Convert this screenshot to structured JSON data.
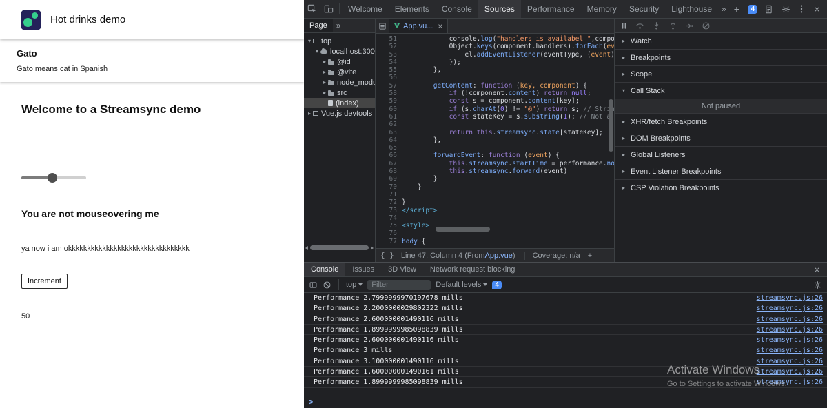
{
  "app": {
    "title": "Hot drinks demo",
    "gato_title": "Gato",
    "gato_subtitle": "Gato means cat in Spanish",
    "welcome_heading": "Welcome to a Streamsync demo",
    "mouseover_heading": "You are not mouseovering me",
    "mouseover_text": "ya now i am okkkkkkkkkkkkkkkkkkkkkkkkkkkkkkkk",
    "increment_button": "Increment",
    "counter_value": "50",
    "slider": {
      "percent": 48
    }
  },
  "devtools": {
    "top_tabs": [
      "Welcome",
      "Elements",
      "Console",
      "Sources",
      "Performance",
      "Memory",
      "Security",
      "Lighthouse"
    ],
    "selected_top_tab": "Sources",
    "more_tabs_icon": "»",
    "new_tab_icon": "+",
    "badge_count": "4",
    "sources": {
      "navigator": {
        "tab_label": "Page",
        "more_icon": "»",
        "tree": [
          {
            "label": "top",
            "depth": 0,
            "state": "expanded",
            "icon": "frame"
          },
          {
            "label": "localhost:3000",
            "depth": 1,
            "state": "expanded",
            "icon": "cloud"
          },
          {
            "label": "@id",
            "depth": 2,
            "state": "collapsed",
            "icon": "folder"
          },
          {
            "label": "@vite",
            "depth": 2,
            "state": "collapsed",
            "icon": "folder"
          },
          {
            "label": "node_modu...",
            "depth": 2,
            "state": "collapsed",
            "icon": "folder"
          },
          {
            "label": "src",
            "depth": 2,
            "state": "collapsed",
            "icon": "folder"
          },
          {
            "label": "(index)",
            "depth": 2,
            "state": "leaf",
            "icon": "file",
            "selected": true
          },
          {
            "label": "Vue.js devtools",
            "depth": 0,
            "state": "collapsed",
            "icon": "frame"
          }
        ]
      },
      "editor": {
        "tab_label": "App.vu...",
        "close_icon": "×",
        "first_line": 51,
        "lines": [
          {
            "n": 51,
            "t": [
              [
                "            console.",
                "p"
              ],
              [
                "log",
                "f"
              ],
              [
                "(",
                "p"
              ],
              [
                "\"handlers is availabel \"",
                "s"
              ],
              [
                ",component",
                "p"
              ]
            ]
          },
          {
            "n": 52,
            "t": [
              [
                "            Object.",
                "p"
              ],
              [
                "keys",
                "f"
              ],
              [
                "(component.handlers).",
                "p"
              ],
              [
                "forEach",
                "f"
              ],
              [
                "(",
                "p"
              ],
              [
                "event",
                "d"
              ]
            ]
          },
          {
            "n": 53,
            "t": [
              [
                "                el.",
                "p"
              ],
              [
                "addEventListener",
                "f"
              ],
              [
                "(eventType, (",
                "p"
              ],
              [
                "event",
                "d"
              ],
              [
                ") =>",
                "p"
              ]
            ]
          },
          {
            "n": 54,
            "t": [
              [
                "            });",
                "p"
              ]
            ]
          },
          {
            "n": 55,
            "t": [
              [
                "        },",
                "p"
              ]
            ]
          },
          {
            "n": 56,
            "t": []
          },
          {
            "n": 57,
            "t": [
              [
                "        ",
                "p"
              ],
              [
                "getContent",
                "f"
              ],
              [
                ": ",
                "p"
              ],
              [
                "function",
                "k"
              ],
              [
                " (",
                "p"
              ],
              [
                "key, component",
                "d"
              ],
              [
                ") {",
                "p"
              ]
            ]
          },
          {
            "n": 58,
            "t": [
              [
                "            ",
                "p"
              ],
              [
                "if",
                "k"
              ],
              [
                " (!component.",
                "p"
              ],
              [
                "content",
                "f"
              ],
              [
                ") ",
                "p"
              ],
              [
                "return",
                "k"
              ],
              [
                " ",
                "p"
              ],
              [
                "null",
                "n"
              ],
              [
                ";",
                "p"
              ]
            ]
          },
          {
            "n": 59,
            "t": [
              [
                "            ",
                "p"
              ],
              [
                "const",
                "k"
              ],
              [
                " s = component.",
                "p"
              ],
              [
                "content",
                "f"
              ],
              [
                "[key];",
                "p"
              ]
            ]
          },
          {
            "n": 60,
            "t": [
              [
                "            ",
                "p"
              ],
              [
                "if",
                "k"
              ],
              [
                " (s.",
                "p"
              ],
              [
                "charAt",
                "f"
              ],
              [
                "(",
                "p"
              ],
              [
                "0",
                "n"
              ],
              [
                ") != ",
                "p"
              ],
              [
                "\"@\"",
                "s"
              ],
              [
                ") ",
                "p"
              ],
              [
                "return",
                "k"
              ],
              [
                " s; ",
                "p"
              ],
              [
                "// String li",
                "c"
              ]
            ]
          },
          {
            "n": 61,
            "t": [
              [
                "            ",
                "p"
              ],
              [
                "const",
                "k"
              ],
              [
                " stateKey = s.",
                "p"
              ],
              [
                "substring",
                "f"
              ],
              [
                "(",
                "p"
              ],
              [
                "1",
                "n"
              ],
              [
                "); ",
                "p"
              ],
              [
                "// Not a stri",
                "c"
              ]
            ]
          },
          {
            "n": 62,
            "t": []
          },
          {
            "n": 63,
            "t": [
              [
                "            ",
                "p"
              ],
              [
                "return",
                "k"
              ],
              [
                " ",
                "p"
              ],
              [
                "this",
                "k"
              ],
              [
                ".",
                "p"
              ],
              [
                "streamsync",
                "f"
              ],
              [
                ".",
                "p"
              ],
              [
                "state",
                "f"
              ],
              [
                "[stateKey];",
                "p"
              ]
            ]
          },
          {
            "n": 64,
            "t": [
              [
                "        },",
                "p"
              ]
            ]
          },
          {
            "n": 65,
            "t": []
          },
          {
            "n": 66,
            "t": [
              [
                "        ",
                "p"
              ],
              [
                "forwardEvent",
                "f"
              ],
              [
                ": ",
                "p"
              ],
              [
                "function",
                "k"
              ],
              [
                " (",
                "p"
              ],
              [
                "event",
                "d"
              ],
              [
                ") {",
                "p"
              ]
            ]
          },
          {
            "n": 67,
            "t": [
              [
                "            ",
                "p"
              ],
              [
                "this",
                "k"
              ],
              [
                ".",
                "p"
              ],
              [
                "streamsync",
                "f"
              ],
              [
                ".",
                "p"
              ],
              [
                "startTime",
                "f"
              ],
              [
                " = performance.",
                "p"
              ],
              [
                "now",
                "f"
              ],
              [
                "();",
                "p"
              ]
            ]
          },
          {
            "n": 68,
            "t": [
              [
                "            ",
                "p"
              ],
              [
                "this",
                "k"
              ],
              [
                ".",
                "p"
              ],
              [
                "streamsync",
                "f"
              ],
              [
                ".",
                "p"
              ],
              [
                "forward",
                "f"
              ],
              [
                "(event)",
                "p"
              ]
            ]
          },
          {
            "n": 69,
            "t": [
              [
                "        }",
                "p"
              ]
            ]
          },
          {
            "n": 70,
            "t": [
              [
                "    }",
                "p"
              ]
            ]
          },
          {
            "n": 71,
            "t": []
          },
          {
            "n": 72,
            "t": [
              [
                "}",
                "p"
              ]
            ]
          },
          {
            "n": 73,
            "t": [
              [
                "</script>",
                "t"
              ]
            ]
          },
          {
            "n": 74,
            "t": []
          },
          {
            "n": 75,
            "t": [
              [
                "<style>",
                "t"
              ]
            ]
          },
          {
            "n": 76,
            "t": []
          },
          {
            "n": 77,
            "t": [
              [
                "body",
                "f"
              ],
              [
                " {",
                "p"
              ]
            ]
          }
        ],
        "status": {
          "braces": "{ }",
          "prefix": "Line 47, Column 4 (From ",
          "link": "App.vue",
          "suffix": ")",
          "coverage": "Coverage: n/a",
          "add": "+"
        }
      },
      "debugger": {
        "items": [
          {
            "type": "section",
            "label": "Watch"
          },
          {
            "type": "section",
            "label": "Breakpoints"
          },
          {
            "type": "section",
            "label": "Scope"
          },
          {
            "type": "section",
            "label": "Call Stack",
            "expanded": true
          },
          {
            "type": "status",
            "label": "Not paused"
          },
          {
            "type": "section",
            "label": "XHR/fetch Breakpoints"
          },
          {
            "type": "section",
            "label": "DOM Breakpoints"
          },
          {
            "type": "section",
            "label": "Global Listeners"
          },
          {
            "type": "section",
            "label": "Event Listener Breakpoints"
          },
          {
            "type": "section",
            "label": "CSP Violation Breakpoints"
          }
        ]
      }
    },
    "console": {
      "tabs": [
        "Console",
        "Issues",
        "3D View",
        "Network request blocking"
      ],
      "selected_tab": "Console",
      "close_icon": "×",
      "toolbar": {
        "context_label": "top",
        "filter_placeholder": "Filter",
        "levels_label": "Default levels",
        "badge_count": "4"
      },
      "messages": [
        {
          "text": "Performance 2.7999999970197678 mills",
          "source": "streamsync.js:26"
        },
        {
          "text": "Performance 2.2000000029802322 mills",
          "source": "streamsync.js:26"
        },
        {
          "text": "Performance 2.600000001490116 mills",
          "source": "streamsync.js:26"
        },
        {
          "text": "Performance 1.8999999985098839 mills",
          "source": "streamsync.js:26"
        },
        {
          "text": "Performance 2.600000001490116 mills",
          "source": "streamsync.js:26"
        },
        {
          "text": "Performance 3 mills",
          "source": "streamsync.js:26"
        },
        {
          "text": "Performance 3.100000001490116 mills",
          "source": "streamsync.js:26"
        },
        {
          "text": "Performance 1.600000001490161 mills",
          "source": "streamsync.js:26"
        },
        {
          "text": "Performance 1.8999999985098839 mills",
          "source": "streamsync.js:26"
        }
      ],
      "prompt": ">"
    }
  },
  "watermark": {
    "line1": "Activate Windows",
    "line2": "Go to Settings to activate Windows."
  }
}
